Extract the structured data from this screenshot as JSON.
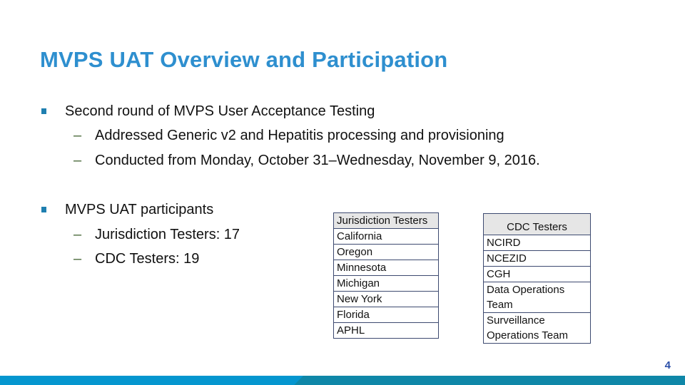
{
  "slide": {
    "title": "MVPS UAT Overview and Participation",
    "page_number": "4",
    "colors": {
      "title": "#2e8fcf",
      "bullet": "#1f7fb0",
      "footer_left": "#0596cf",
      "footer_right": "#0f87a8",
      "page_number": "#2b4fa8"
    }
  },
  "bullets": [
    {
      "text": "Second round of MVPS User Acceptance Testing",
      "subs": [
        "Addressed Generic v2 and Hepatitis processing and provisioning",
        "Conducted from Monday, October 31–Wednesday, November 9, 2016."
      ]
    },
    {
      "text": "MVPS UAT participants",
      "subs": [
        "Jurisdiction Testers: 17",
        "CDC Testers: 19"
      ]
    }
  ],
  "dash": "–",
  "jurisdiction_table": {
    "header": "Jurisdiction Testers",
    "rows": [
      "California",
      "Oregon",
      "Minnesota",
      "Michigan",
      "New York",
      "Florida",
      "APHL"
    ]
  },
  "cdc_table": {
    "header": "CDC Testers",
    "rows": [
      "NCIRD",
      "NCEZID",
      "CGH",
      "Data Operations Team",
      "Surveillance Operations Team"
    ]
  }
}
